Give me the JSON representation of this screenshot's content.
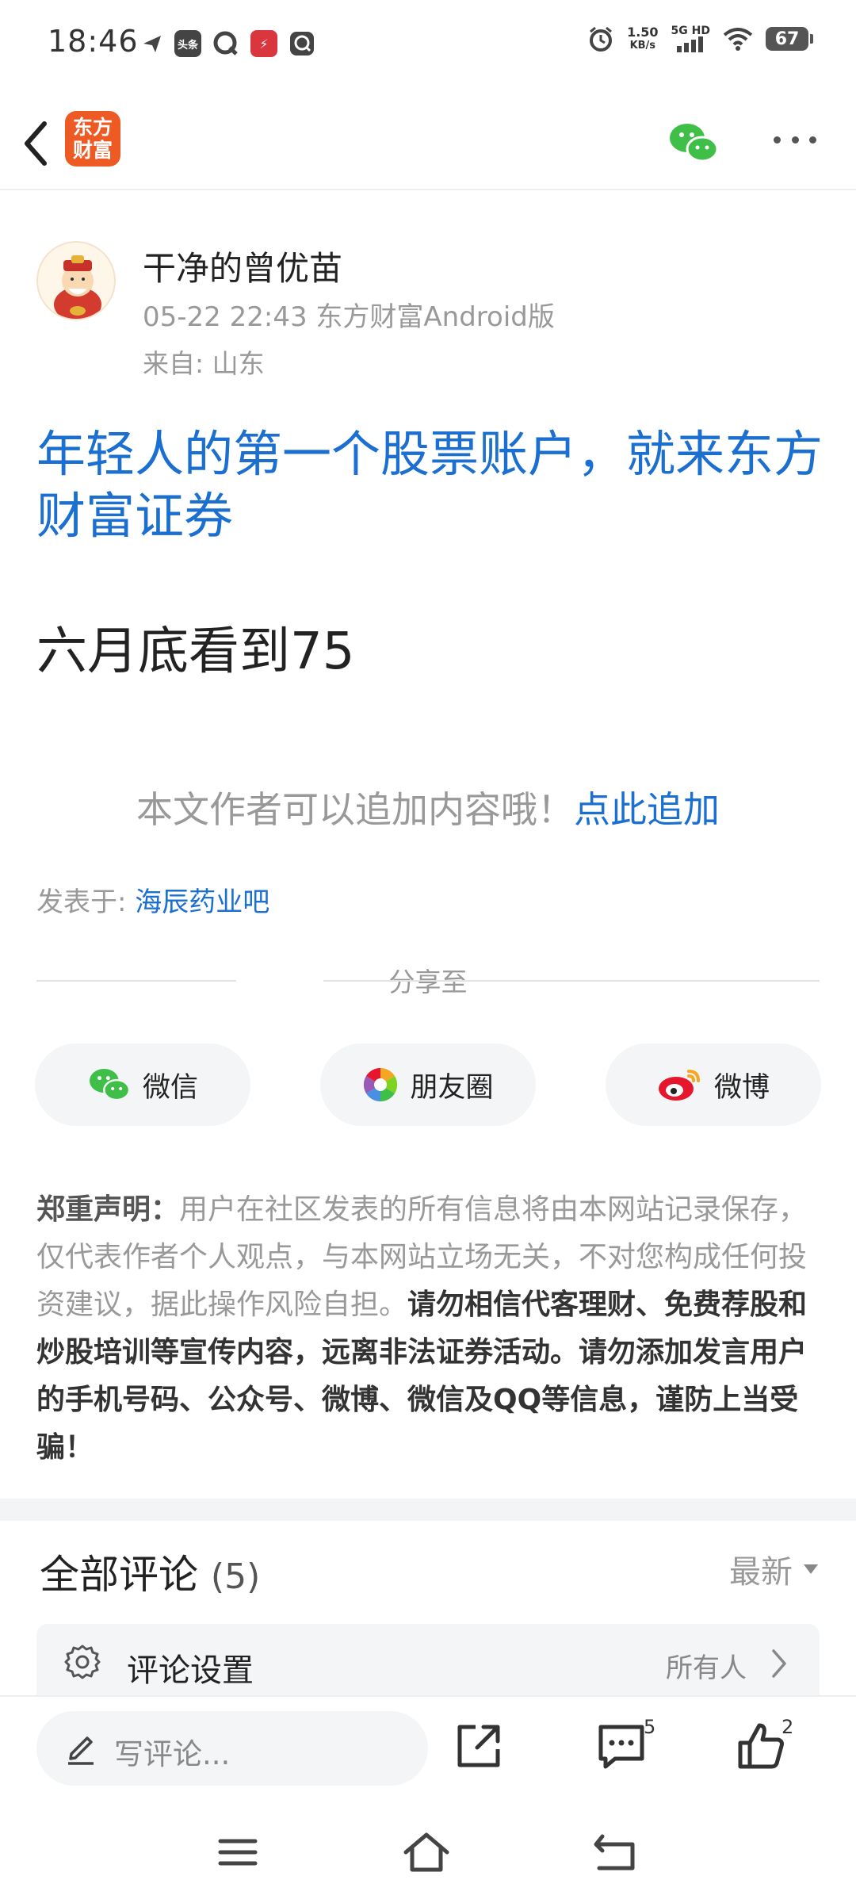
{
  "status_bar": {
    "time": "18:46",
    "net_speed_value": "1.50",
    "net_speed_unit": "KB/s",
    "network_type": "5G HD",
    "battery": "67"
  },
  "header": {
    "logo_text_line1": "东方",
    "logo_text_line2": "财富"
  },
  "post": {
    "author": "干净的曾优苗",
    "meta": "05-22 22:43 东方财富Android版",
    "from": "来自: 山东",
    "headline": "年轻人的第一个股票账户，就来东方财富证券",
    "body": "六月底看到75",
    "append_prompt": "本文作者可以追加内容哦！",
    "append_link": "点此追加",
    "posted_in_label": "发表于: ",
    "posted_in_bar": "海辰药业吧"
  },
  "share": {
    "label": "分享至",
    "buttons": [
      {
        "label": "微信",
        "icon": "wechat-icon"
      },
      {
        "label": "朋友圈",
        "icon": "moments-icon"
      },
      {
        "label": "微博",
        "icon": "weibo-icon"
      }
    ]
  },
  "disclaimer": {
    "title": "郑重声明：",
    "normal": "用户在社区发表的所有信息将由本网站记录保存，仅代表作者个人观点，与本网站立场无关，不对您构成任何投资建议，据此操作风险自担。",
    "bold": "请勿相信代客理财、免费荐股和炒股培训等宣传内容，远离非法证券活动。请勿添加发言用户的手机号码、公众号、微博、微信及QQ等信息，谨防上当受骗！"
  },
  "comments": {
    "title": "全部评论",
    "count": "(5)",
    "sort": "最新",
    "settings_label": "评论设置",
    "settings_value": "所有人"
  },
  "bottom_bar": {
    "placeholder": "写评论...",
    "comment_count": "5",
    "like_count": "2"
  },
  "colors": {
    "accent_blue": "#1a6fd1",
    "logo_orange": "#ee5a24",
    "wechat_green": "#3fbf47",
    "weibo_red": "#e6162d"
  }
}
